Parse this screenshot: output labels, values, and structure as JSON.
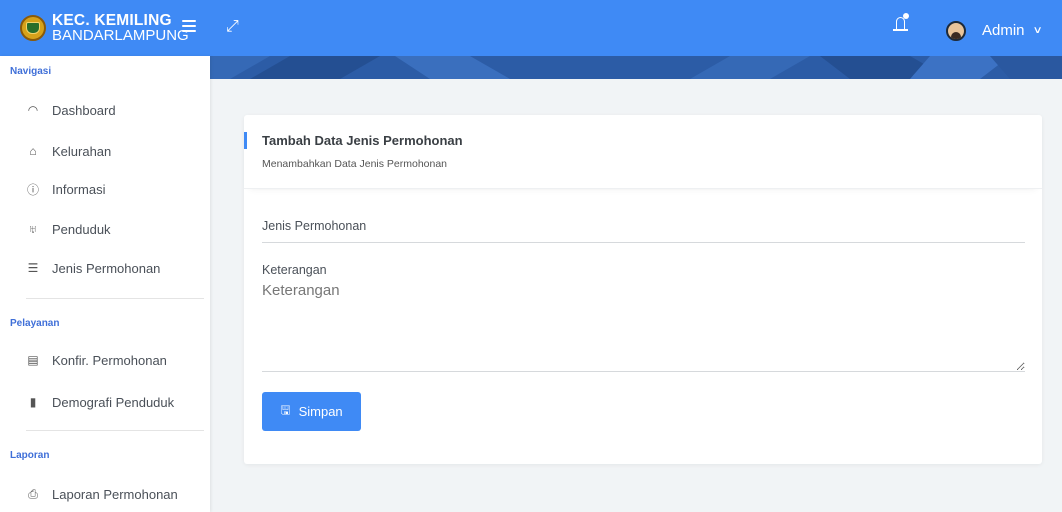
{
  "brand": {
    "title": "KEC. KEMILING",
    "subtitle": "BANDARLAMPUNG"
  },
  "header": {
    "user_name": "Admin"
  },
  "sidebar": {
    "sections": [
      {
        "label": "Navigasi",
        "items": [
          {
            "label": "Dashboard",
            "icon": "dashboard-icon"
          },
          {
            "label": "Kelurahan",
            "icon": "home-icon"
          },
          {
            "label": "Informasi",
            "icon": "info-icon"
          },
          {
            "label": "Penduduk",
            "icon": "user-icon"
          },
          {
            "label": "Jenis Permohonan",
            "icon": "list-icon"
          }
        ]
      },
      {
        "label": "Pelayanan",
        "items": [
          {
            "label": "Konfir. Permohonan",
            "icon": "document-icon"
          },
          {
            "label": "Demografi Penduduk",
            "icon": "bookmark-icon"
          }
        ]
      },
      {
        "label": "Laporan",
        "items": [
          {
            "label": "Laporan Permohonan",
            "icon": "printer-icon"
          }
        ]
      }
    ]
  },
  "card": {
    "title": "Tambah Data Jenis Permohonan",
    "subtitle": "Menambahkan Data Jenis Permohonan"
  },
  "form": {
    "jenis_placeholder": "Jenis Permohonan",
    "keterangan_label": "Keterangan",
    "keterangan_placeholder": "Keterangan",
    "submit_label": "Simpan"
  }
}
